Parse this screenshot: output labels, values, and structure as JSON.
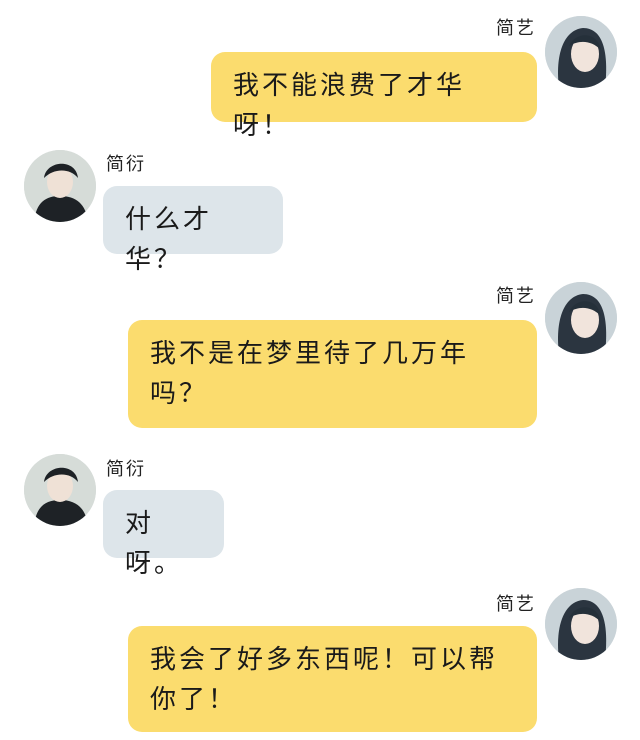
{
  "conversation": {
    "messages": [
      {
        "sender": "简艺",
        "side": "right",
        "text": "我不能浪费了才华呀！"
      },
      {
        "sender": "简衍",
        "side": "left",
        "text": "什么才华？"
      },
      {
        "sender": "简艺",
        "side": "right",
        "text": "我不是在梦里待了几万年吗？"
      },
      {
        "sender": "简衍",
        "side": "left",
        "text": "对呀。"
      },
      {
        "sender": "简艺",
        "side": "right",
        "text": "我会了好多东西呢！可以帮你了！"
      }
    ]
  },
  "colors": {
    "right_bubble": "#fbdc6e",
    "left_bubble": "#dde5ea",
    "background": "#ffffff"
  },
  "icons": {
    "right_avatar": "girl-avatar-icon",
    "left_avatar": "boy-avatar-icon"
  }
}
